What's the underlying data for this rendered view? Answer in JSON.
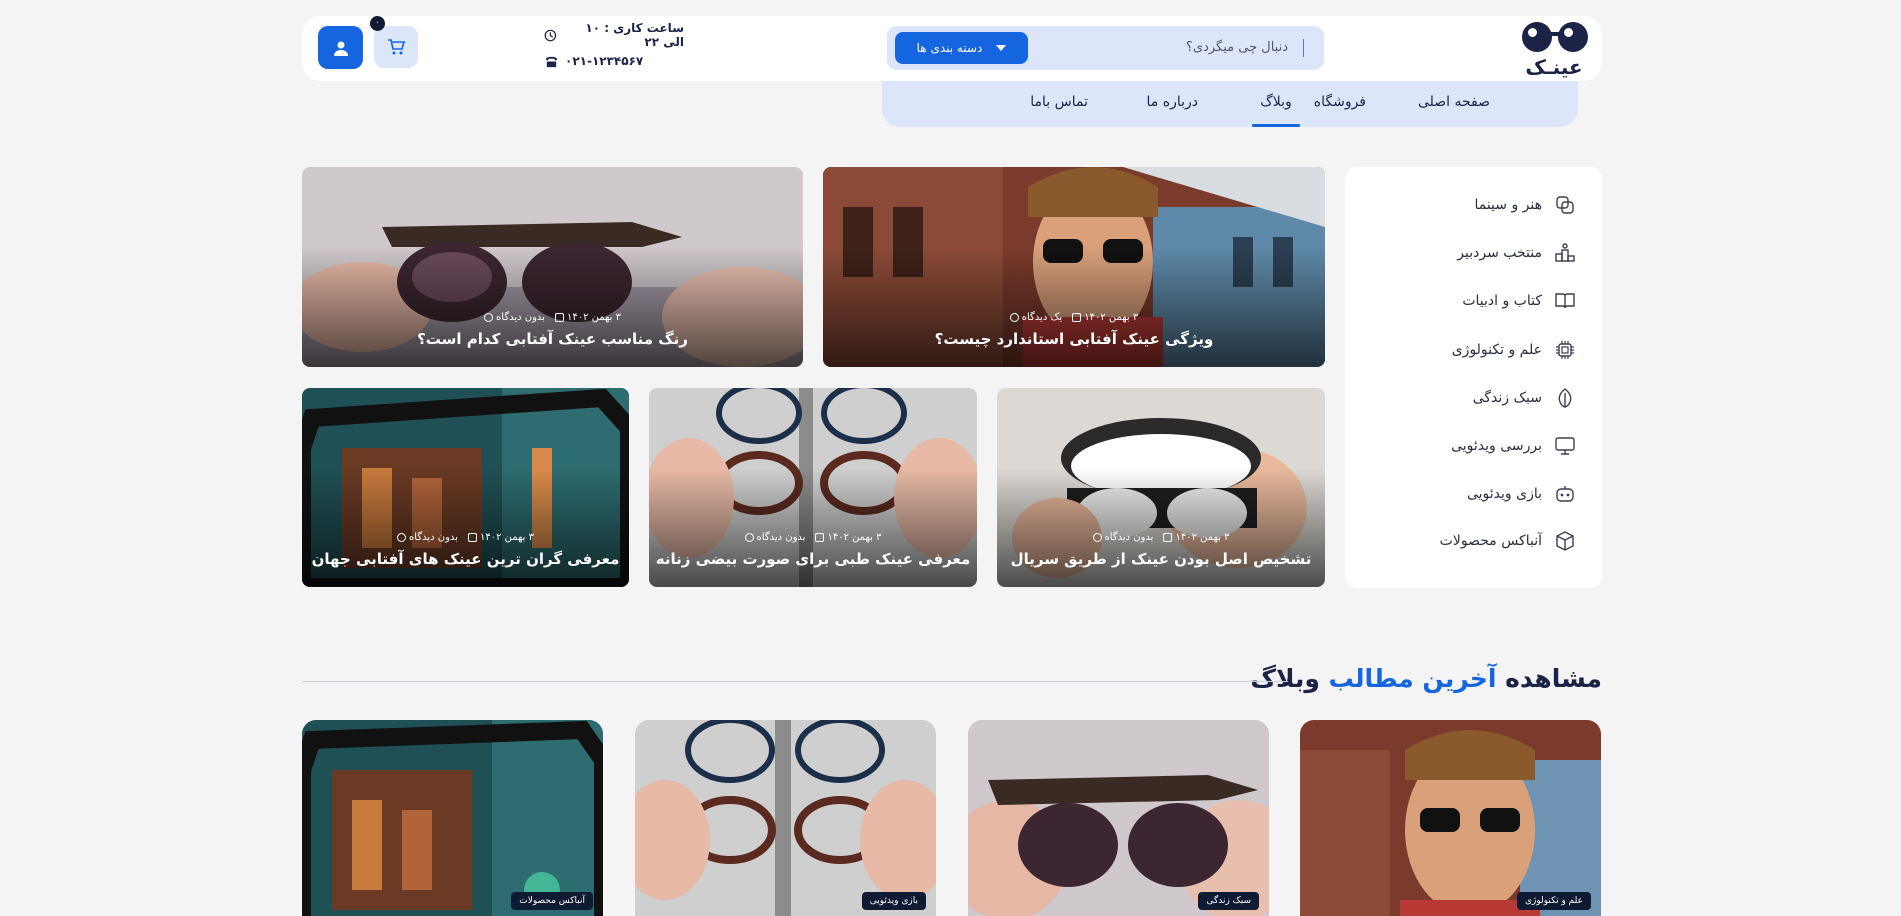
{
  "header": {
    "logo_text": "عینـک",
    "search_placeholder": "دنبال چی میگردی؟",
    "category_button": "دسته بندی ها",
    "working_hours": "ساعت کاری : ۱۰ الی ۲۲",
    "phone": "۰۲۱-۱۲۳۴۵۶۷",
    "cart_count": "۰"
  },
  "nav": {
    "items": [
      {
        "label": "صفحه اصلی"
      },
      {
        "label": "فروشگاه"
      },
      {
        "label": "وبلاگ"
      },
      {
        "label": "درباره ما"
      },
      {
        "label": "تماس باما"
      }
    ]
  },
  "sidebar": {
    "items": [
      {
        "label": "هنر و سینما",
        "icon": "palette-icon"
      },
      {
        "label": "منتخب سردبیر",
        "icon": "podium-icon"
      },
      {
        "label": "کتاب و ادبیات",
        "icon": "book-icon"
      },
      {
        "label": "علم و تکنولوژی",
        "icon": "chip-icon"
      },
      {
        "label": "سبک زندگی",
        "icon": "leaf-icon"
      },
      {
        "label": "بررسی ویدئویی",
        "icon": "monitor-icon"
      },
      {
        "label": "بازی ویدئویی",
        "icon": "gamepad-icon"
      },
      {
        "label": "آنباکس محصولات",
        "icon": "box-icon"
      }
    ]
  },
  "featured": [
    {
      "title": "ویژگی عینک آفتابی استاندارد چیست؟",
      "date": "۳ بهمن ۱۴۰۲",
      "comments": "یک دیدگاه"
    },
    {
      "title": "رنگ مناسب عینک آفتابی کدام است؟",
      "date": "۳ بهمن ۱۴۰۲",
      "comments": "بدون دیدگاه"
    },
    {
      "title": "تشخیص اصل بودن عینک از طریق سریال",
      "date": "۳ بهمن ۱۴۰۲",
      "comments": "بدون دیدگاه"
    },
    {
      "title": "معرفی عینک طبی برای صورت بیضی زنانه",
      "date": "۳ بهمن ۱۴۰۲",
      "comments": "بدون دیدگاه"
    },
    {
      "title": "معرفی گران ترین عینک های آفتابی جهان",
      "date": "۳ بهمن ۱۴۰۲",
      "comments": "بدون دیدگاه"
    }
  ],
  "latest": {
    "title_prefix": "مشاهده",
    "title_highlight": "آخرین مطالب",
    "title_suffix": "وبلاگ",
    "posts": [
      {
        "tag": "علم و تکنولوژی"
      },
      {
        "tag": "سبک زندگی"
      },
      {
        "tag": "بازی ویدئویی"
      },
      {
        "tag": "آنباکس محصولات"
      }
    ]
  },
  "colors": {
    "accent": "#1565e0",
    "accent_light": "#dbe6fb",
    "dark": "#1b2347",
    "background": "#f4f4f5"
  }
}
